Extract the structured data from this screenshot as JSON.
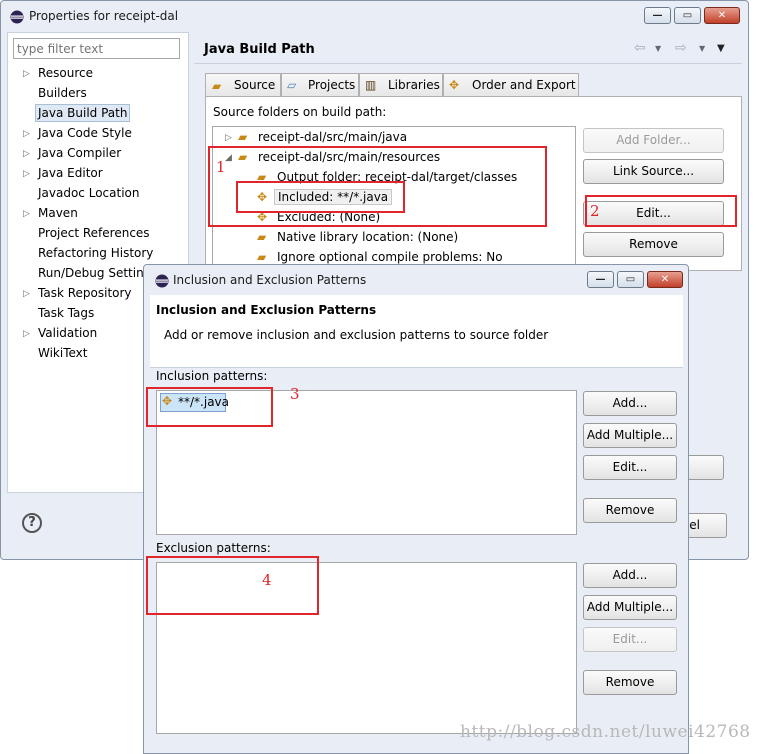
{
  "properties_window": {
    "title": "Properties for receipt-dal",
    "filter_placeholder": "type filter text",
    "nav_items": [
      {
        "label": "Resource",
        "expandable": true
      },
      {
        "label": "Builders",
        "expandable": false
      },
      {
        "label": "Java Build Path",
        "expandable": false,
        "selected": true
      },
      {
        "label": "Java Code Style",
        "expandable": true
      },
      {
        "label": "Java Compiler",
        "expandable": true
      },
      {
        "label": "Java Editor",
        "expandable": true
      },
      {
        "label": "Javadoc Location",
        "expandable": false
      },
      {
        "label": "Maven",
        "expandable": true
      },
      {
        "label": "Project References",
        "expandable": false
      },
      {
        "label": "Refactoring History",
        "expandable": false
      },
      {
        "label": "Run/Debug Settings",
        "expandable": false
      },
      {
        "label": "Task Repository",
        "expandable": true
      },
      {
        "label": "Task Tags",
        "expandable": false
      },
      {
        "label": "Validation",
        "expandable": true
      },
      {
        "label": "WikiText",
        "expandable": false
      }
    ],
    "page_title": "Java Build Path",
    "tabs": [
      "Source",
      "Projects",
      "Libraries",
      "Order and Export"
    ],
    "source_folders_label": "Source folders on build path:",
    "tree": [
      {
        "label": "receipt-dal/src/main/java"
      },
      {
        "label": "receipt-dal/src/main/resources"
      },
      {
        "label": "Output folder: receipt-dal/target/classes"
      },
      {
        "label": "Included: **/*.java"
      },
      {
        "label": "Excluded: (None)"
      },
      {
        "label": "Native library location: (None)"
      },
      {
        "label": "Ignore optional compile problems: No"
      }
    ],
    "buttons": {
      "add_folder": "Add Folder...",
      "link_source": "Link Source...",
      "edit": "Edit...",
      "remove": "Remove",
      "cancel_partial": "el"
    },
    "help_glyph": "?"
  },
  "dialog": {
    "title": "Inclusion and Exclusion Patterns",
    "heading": "Inclusion and Exclusion Patterns",
    "description": "Add or remove inclusion and exclusion patterns to source folder",
    "inclusion_label": "Inclusion patterns:",
    "inclusion_items": [
      "**/*.java"
    ],
    "exclusion_label": "Exclusion patterns:",
    "inclusion_buttons": {
      "add": "Add...",
      "add_multiple": "Add Multiple...",
      "edit": "Edit...",
      "remove": "Remove"
    },
    "exclusion_buttons": {
      "add": "Add...",
      "add_multiple": "Add Multiple...",
      "edit": "Edit...",
      "remove": "Remove"
    }
  },
  "annotations": {
    "label1": "1",
    "label2": "2",
    "label3": "3",
    "label4": "4"
  },
  "watermark": "http://blog.csdn.net/luwei42768",
  "colors": {
    "annotation_red": "#e0262a",
    "selection": "#cce4f7",
    "chrome": "#e9eef6"
  }
}
